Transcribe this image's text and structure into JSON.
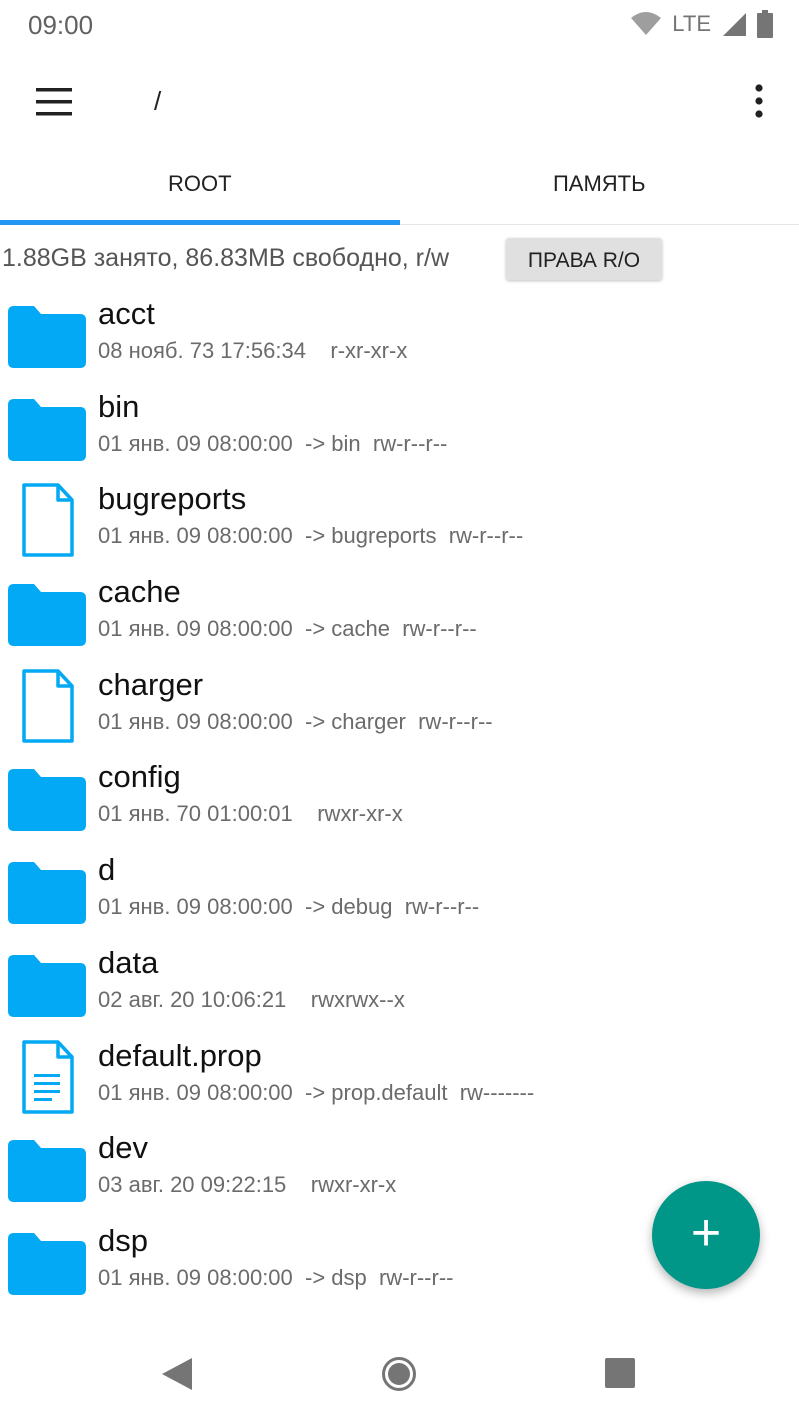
{
  "status_bar": {
    "time": "09:00",
    "network": "LTE",
    "icons": [
      "wifi-icon",
      "signal-icon",
      "battery-icon"
    ]
  },
  "app_bar": {
    "path": "/",
    "icons": [
      "menu-icon",
      "more-vert-icon"
    ]
  },
  "tabs": [
    {
      "label": "ROOT",
      "active": true
    },
    {
      "label": "ПАМЯТЬ",
      "active": false
    }
  ],
  "storage": {
    "info": "1.88GB занято, 86.83MB свободно, r/w",
    "button_label": "ПРАВА R/O"
  },
  "files": [
    {
      "name": "acct",
      "meta": "08 нояб. 73 17:56:34    r-xr-xr-x",
      "icon": "folder-icon"
    },
    {
      "name": "bin",
      "meta": "01 янв. 09 08:00:00  -> bin  rw-r--r--",
      "icon": "folder-icon"
    },
    {
      "name": "bugreports",
      "meta": "01 янв. 09 08:00:00  -> bugreports  rw-r--r--",
      "icon": "file-icon"
    },
    {
      "name": "cache",
      "meta": "01 янв. 09 08:00:00  -> cache  rw-r--r--",
      "icon": "folder-icon"
    },
    {
      "name": "charger",
      "meta": "01 янв. 09 08:00:00  -> charger  rw-r--r--",
      "icon": "file-icon"
    },
    {
      "name": "config",
      "meta": "01 янв. 70 01:00:01    rwxr-xr-x",
      "icon": "folder-icon"
    },
    {
      "name": "d",
      "meta": "01 янв. 09 08:00:00  -> debug  rw-r--r--",
      "icon": "folder-icon"
    },
    {
      "name": "data",
      "meta": "02 авг. 20 10:06:21    rwxrwx--x",
      "icon": "folder-icon"
    },
    {
      "name": "default.prop",
      "meta": "01 янв. 09 08:00:00  -> prop.default  rw-------",
      "icon": "text-file-icon"
    },
    {
      "name": "dev",
      "meta": "03 авг. 20 09:22:15    rwxr-xr-x",
      "icon": "folder-icon"
    },
    {
      "name": "dsp",
      "meta": "01 янв. 09 08:00:00  -> dsp  rw-r--r--",
      "icon": "folder-icon"
    }
  ],
  "fab": {
    "label": "+",
    "icon": "add-icon"
  },
  "nav_bar": {
    "icons": [
      "back-icon",
      "home-icon",
      "recents-icon"
    ]
  },
  "colors": {
    "folder": "#03a9f4",
    "tab_indicator": "#2196f3",
    "fab": "#009688"
  }
}
